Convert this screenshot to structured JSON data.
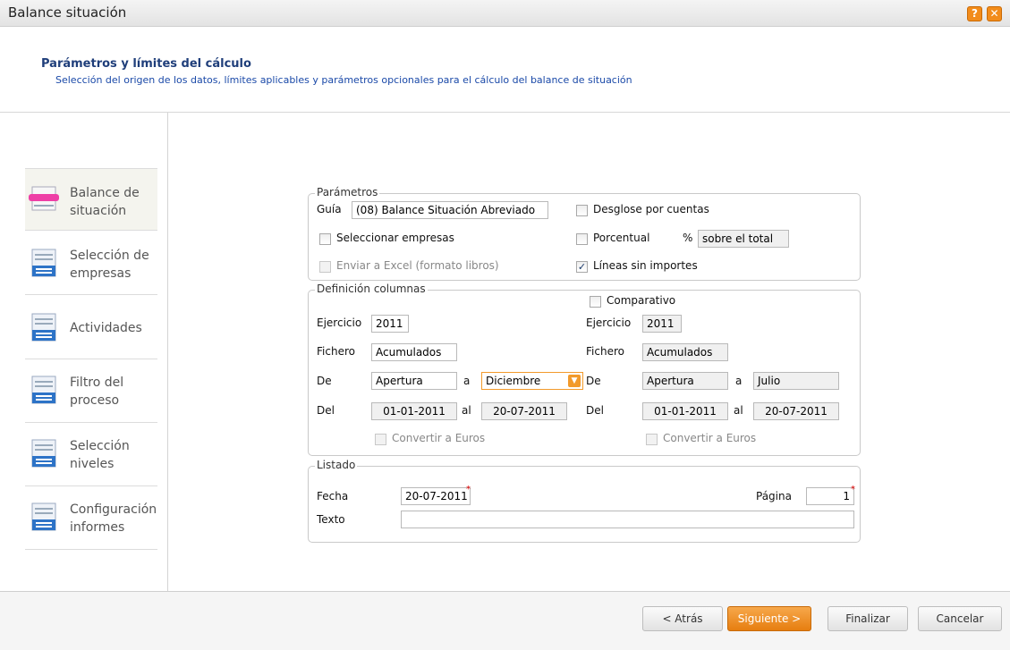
{
  "window": {
    "title": "Balance situación",
    "help_label": "?",
    "close_label": "✕"
  },
  "header": {
    "title": "Parámetros y límites del cálculo",
    "subtitle": "Selección del origen de los datos, límites aplicables y parámetros opcionales para el cálculo del balance de situación"
  },
  "sidebar": {
    "items": [
      {
        "line1": "Balance de",
        "line2": "situación",
        "icon": "balance-icon"
      },
      {
        "line1": "Selección de",
        "line2": "empresas",
        "icon": "list-icon"
      },
      {
        "line1": "Actividades",
        "line2": "",
        "icon": "list-icon"
      },
      {
        "line1": "Filtro del",
        "line2": "proceso",
        "icon": "list-icon"
      },
      {
        "line1": "Selección",
        "line2": "niveles",
        "icon": "list-icon"
      },
      {
        "line1": "Configuración",
        "line2": "informes",
        "icon": "list-icon"
      }
    ]
  },
  "parametros": {
    "legend": "Parámetros",
    "guia_label": "Guía",
    "guia_value": "(08) Balance Situación Abreviado",
    "desglose_label": "Desglose por cuentas",
    "seleccionar_label": "Seleccionar empresas",
    "porcentual_label": "Porcentual",
    "percent_sign": "%",
    "sobre_value": "sobre el total",
    "excel_label": "Enviar a Excel (formato libros)",
    "lineas_label": "Líneas sin importes"
  },
  "columnas": {
    "legend": "Definición columnas",
    "comparativo_label": "Comparativo",
    "left": {
      "ejercicio_label": "Ejercicio",
      "ejercicio_value": "2011",
      "fichero_label": "Fichero",
      "fichero_value": "Acumulados",
      "de_label": "De",
      "de_value": "Apertura",
      "a_label": "a",
      "a_value": "Diciembre",
      "del_label": "Del",
      "del_value": "01-01-2011",
      "al_label": "al",
      "al_value": "20-07-2011",
      "convertir_label": "Convertir a Euros"
    },
    "right": {
      "ejercicio_label": "Ejercicio",
      "ejercicio_value": "2011",
      "fichero_label": "Fichero",
      "fichero_value": "Acumulados",
      "de_label": "De",
      "de_value": "Apertura",
      "a_label": "a",
      "a_value": "Julio",
      "del_label": "Del",
      "del_value": "01-01-2011",
      "al_label": "al",
      "al_value": "20-07-2011",
      "convertir_label": "Convertir a Euros"
    }
  },
  "listado": {
    "legend": "Listado",
    "fecha_label": "Fecha",
    "fecha_value": "20-07-2011",
    "pagina_label": "Página",
    "pagina_value": "1",
    "texto_label": "Texto",
    "texto_value": ""
  },
  "footer": {
    "back_label": "< Atrás",
    "next_label": "Siguiente >",
    "finish_label": "Finalizar",
    "cancel_label": "Cancelar"
  },
  "colors": {
    "accent": "#f28c1b",
    "title": "#1f3e7a"
  }
}
